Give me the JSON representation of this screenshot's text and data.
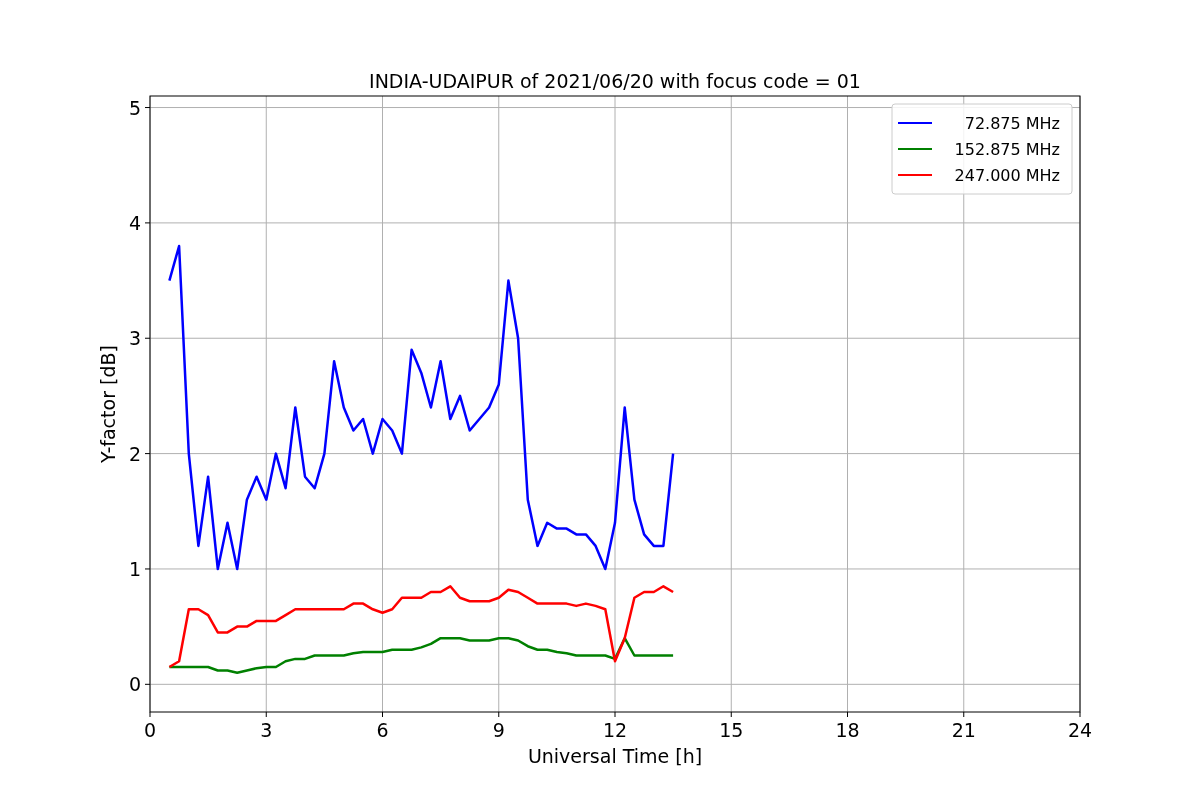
{
  "figure": {
    "chart_data": {
      "type": "line",
      "title": "INDIA-UDAIPUR of 2021/06/20 with focus code = 01",
      "xlabel": "Universal Time [h]",
      "ylabel": "Y-factor [dB]",
      "x": [
        0.5,
        0.75,
        1,
        1.25,
        1.5,
        1.75,
        2,
        2.25,
        2.5,
        2.75,
        3,
        3.25,
        3.5,
        3.75,
        4,
        4.25,
        4.5,
        4.75,
        5,
        5.25,
        5.5,
        5.75,
        6,
        6.25,
        6.5,
        6.75,
        7,
        7.25,
        7.5,
        7.75,
        8,
        8.25,
        8.5,
        8.75,
        9,
        9.25,
        9.5,
        9.75,
        10,
        10.25,
        10.5,
        10.75,
        11,
        11.25,
        11.5,
        11.75,
        12,
        12.25,
        12.5,
        12.75,
        13,
        13.25,
        13.5
      ],
      "series": [
        {
          "name": " 72.875 MHz",
          "color": "#0000ff",
          "values": [
            3.5,
            3.8,
            2.0,
            1.2,
            1.8,
            1.0,
            1.4,
            1.0,
            1.6,
            1.8,
            1.6,
            2.0,
            1.7,
            2.4,
            1.8,
            1.7,
            2.0,
            2.8,
            2.4,
            2.2,
            2.3,
            2.0,
            2.3,
            2.2,
            2.0,
            2.9,
            2.7,
            2.4,
            2.8,
            2.3,
            2.5,
            2.2,
            2.3,
            2.4,
            2.6,
            3.5,
            3.0,
            1.6,
            1.2,
            1.4,
            1.35,
            1.35,
            1.3,
            1.3,
            1.2,
            1.0,
            1.4,
            2.4,
            1.6,
            1.3,
            1.2,
            1.2,
            2.0
          ]
        },
        {
          "name": "152.875 MHz",
          "color": "#008000",
          "values": [
            0.15,
            0.15,
            0.15,
            0.15,
            0.15,
            0.12,
            0.12,
            0.1,
            0.12,
            0.14,
            0.15,
            0.15,
            0.2,
            0.22,
            0.22,
            0.25,
            0.25,
            0.25,
            0.25,
            0.27,
            0.28,
            0.28,
            0.28,
            0.3,
            0.3,
            0.3,
            0.32,
            0.35,
            0.4,
            0.4,
            0.4,
            0.38,
            0.38,
            0.38,
            0.4,
            0.4,
            0.38,
            0.33,
            0.3,
            0.3,
            0.28,
            0.27,
            0.25,
            0.25,
            0.25,
            0.25,
            0.22,
            0.4,
            0.25,
            0.25,
            0.25,
            0.25,
            0.25
          ]
        },
        {
          "name": "247.000 MHz",
          "color": "#ff0000",
          "values": [
            0.15,
            0.2,
            0.65,
            0.65,
            0.6,
            0.45,
            0.45,
            0.5,
            0.5,
            0.55,
            0.55,
            0.55,
            0.6,
            0.65,
            0.65,
            0.65,
            0.65,
            0.65,
            0.65,
            0.7,
            0.7,
            0.65,
            0.62,
            0.65,
            0.75,
            0.75,
            0.75,
            0.8,
            0.8,
            0.85,
            0.75,
            0.72,
            0.72,
            0.72,
            0.75,
            0.82,
            0.8,
            0.75,
            0.7,
            0.7,
            0.7,
            0.7,
            0.68,
            0.7,
            0.68,
            0.65,
            0.2,
            0.4,
            0.75,
            0.8,
            0.8,
            0.85,
            0.8
          ]
        }
      ],
      "xlim": [
        0,
        24
      ],
      "ylim": [
        -0.24,
        5.1
      ],
      "xticks": [
        0,
        3,
        6,
        9,
        12,
        15,
        18,
        21,
        24
      ],
      "yticks": [
        0,
        1,
        2,
        3,
        4,
        5
      ],
      "grid": true,
      "legend": true
    }
  }
}
